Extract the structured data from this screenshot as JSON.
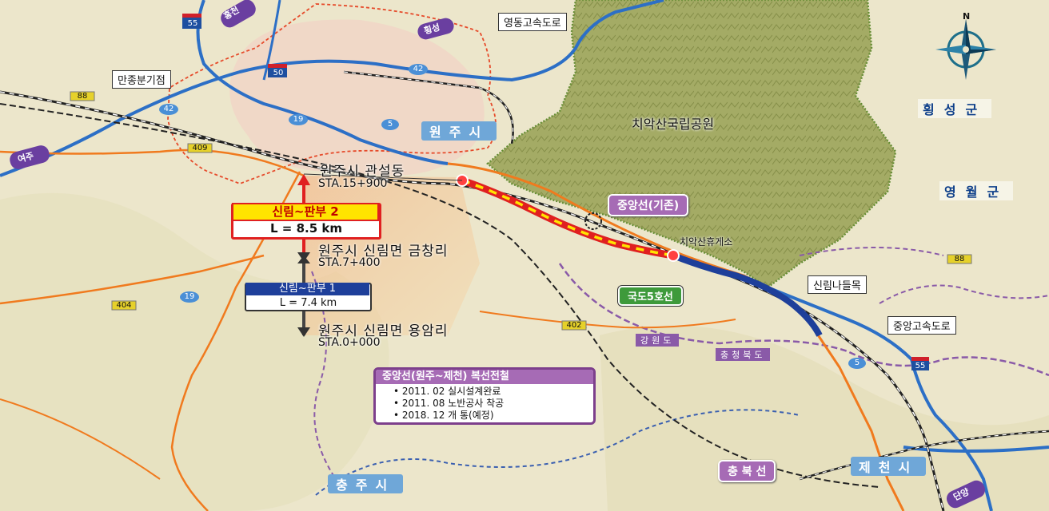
{
  "map": {
    "places": {
      "yeongdong_expressway": "영동고속도로",
      "manjong_jct": "만종분기점",
      "wonju_si": "원주시",
      "chiaksan_park": "치악산국립공원",
      "hoengseong_gun": "횡성군",
      "yeongwol_gun": "영월군",
      "chiaksan_rest": "치악산휴게소",
      "sillim_ic": "신림나들목",
      "jungang_expressway": "중앙고속도로",
      "gangwon_do": "강원도",
      "chungbuk_do": "충청북도",
      "jecheon_si": "제천시",
      "chungju_si": "충주시"
    },
    "direction_badges": {
      "hongcheon": "홍천",
      "hoengseong": "횡성",
      "yeoju": "여주",
      "danyang": "단양"
    },
    "route_numbers": {
      "expressway_55_top": "55",
      "expressway_50": "50",
      "expressway_55_bottom": "55",
      "road_42_top": "42",
      "road_42_left": "42",
      "road_88_left": "88",
      "road_88_right": "88",
      "road_19_top": "19",
      "road_19_bottom": "19",
      "road_5_top": "5",
      "road_5_bottom": "5",
      "road_409": "409",
      "road_404": "404",
      "road_402": "402"
    },
    "rail_labels": {
      "jungang_existing": "중앙선(기존)",
      "chungbuk_line": "충 북 선",
      "national_road_5": "국도5호선"
    },
    "points": {
      "gwanseol_dong": "원주시 관설동",
      "sta_15900": "STA.15+900",
      "geumchang_ri": "원주시 신림면 금창리",
      "sta_7400": "STA.7+400",
      "yongam_ri": "원주시 신림면 용암리",
      "sta_0000": "STA.0+000"
    },
    "sections": {
      "section2": {
        "title": "신림~판부 2",
        "length": "L = 8.5 km"
      },
      "section1": {
        "title": "신림~판부 1",
        "length": "L = 7.4 km"
      }
    },
    "info_box": {
      "title": "중앙선(원주~제천) 복선전철",
      "items": [
        "2011. 02 실시설계완료",
        "2011. 08 노반공사 착공",
        "2018. 12 개 통(예정)"
      ]
    },
    "compass_label": "N",
    "colors": {
      "section2_red": "#e02020",
      "section2_yellow": "#ffe400",
      "section1_blue": "#1e3f9a",
      "rail_purple": "#a66bb5",
      "park_green": "#8f9a55"
    }
  }
}
